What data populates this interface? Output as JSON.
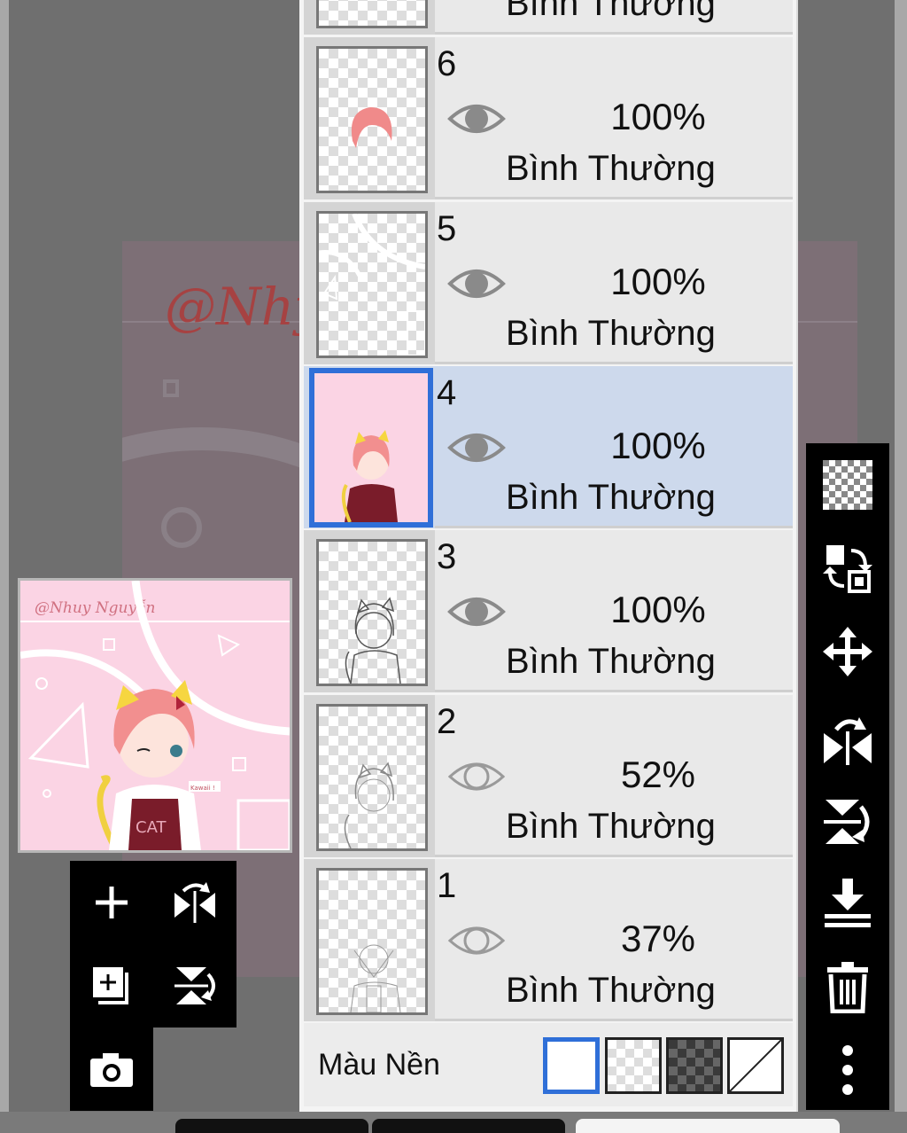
{
  "layers": [
    {
      "number": "6",
      "opacity": "100%",
      "blend": "Bình Thường",
      "visible": true,
      "thumb": "hair-pink"
    },
    {
      "number": "5",
      "opacity": "100%",
      "blend": "Bình Thường",
      "visible": true,
      "thumb": "white-lines"
    },
    {
      "number": "4",
      "opacity": "100%",
      "blend": "Bình Thường",
      "visible": true,
      "thumb": "pink-full",
      "selected": true
    },
    {
      "number": "3",
      "opacity": "100%",
      "blend": "Bình Thường",
      "visible": true,
      "thumb": "lineart"
    },
    {
      "number": "2",
      "opacity": "52%",
      "blend": "Bình Thường",
      "visible": false,
      "thumb": "sketch"
    },
    {
      "number": "1",
      "opacity": "37%",
      "blend": "Bình Thường",
      "visible": false,
      "thumb": "rough"
    }
  ],
  "top_partial_layer": {
    "blend": "Bình Thường"
  },
  "background": {
    "label": "Màu Nền",
    "options": [
      "white",
      "transparent",
      "dark-checker",
      "none"
    ],
    "selected": "white"
  },
  "canvas": {
    "signature": "@Nhy y"
  },
  "preview": {
    "signature": "@Nhuy Nguyễn",
    "shirt_text": "CAT",
    "tag_text": "Kawaii !"
  },
  "right_toolbar": [
    "transparency-icon",
    "swap-layer-icon",
    "move-icon",
    "flip-horizontal-icon",
    "flip-vertical-icon",
    "merge-down-icon",
    "trash-icon",
    "more-icon"
  ],
  "mini_toolbar": [
    "add-layer-icon",
    "flip-horizontal-icon",
    "add-copy-icon",
    "flip-vertical-icon",
    "camera-icon"
  ],
  "colors": {
    "selected_blue": "#2f6fd8",
    "selected_row": "#cdd9ec",
    "canvas_pink": "#fbd4e4"
  }
}
